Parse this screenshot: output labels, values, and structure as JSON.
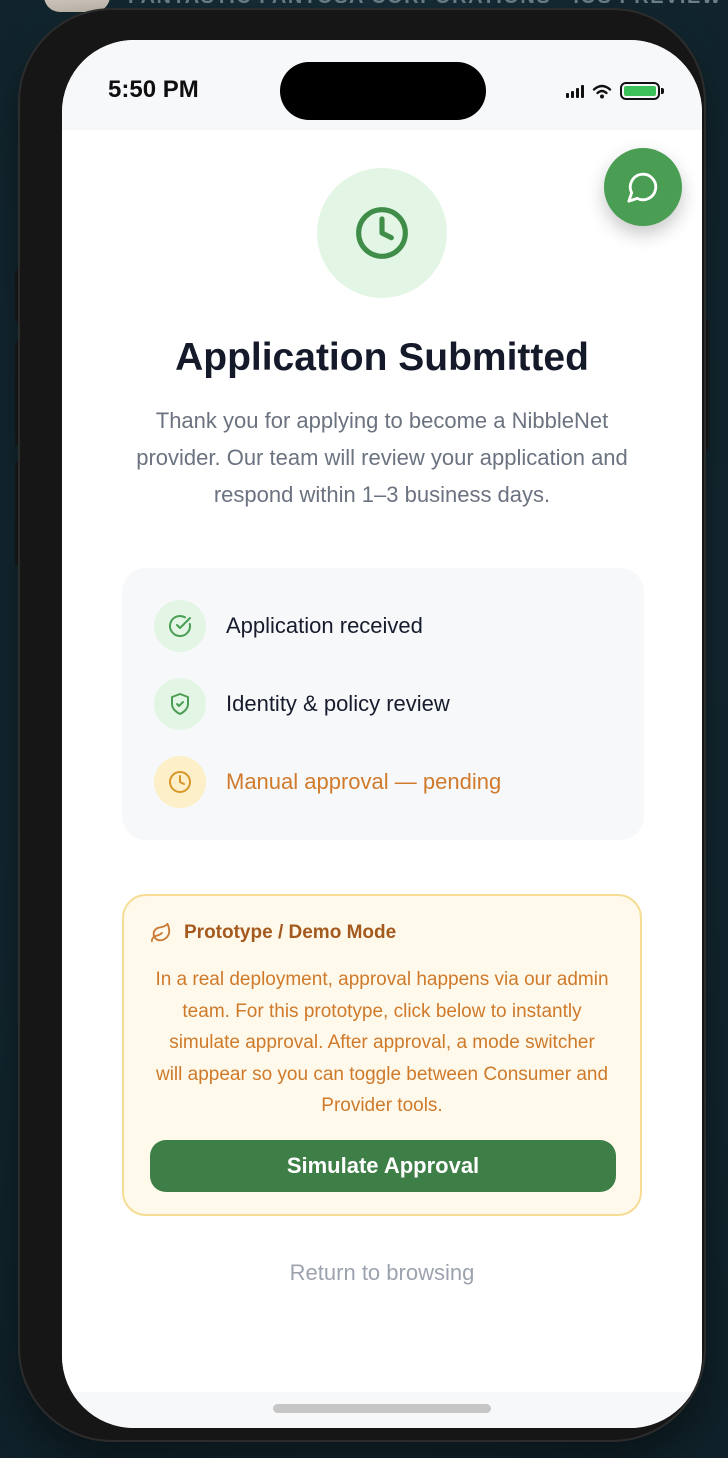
{
  "banner": {
    "text": "FANTASTIC FANTOSA CORPORATIONS · IOS PREVIEW"
  },
  "status_bar": {
    "time": "5:50 PM",
    "battery_color": "#3cc15a"
  },
  "chat_button": {
    "icon": "chat-bubble-icon",
    "color": "#4a9e53"
  },
  "hero": {
    "icon": "clock-icon",
    "title": "Application Submitted",
    "subtitle": "Thank you for applying to become a NibbleNet provider. Our team will review your application and respond within 1–3 business days."
  },
  "steps": [
    {
      "label": "Application received",
      "icon": "check-circle-icon",
      "status": "done"
    },
    {
      "label": "Identity & policy review",
      "icon": "shield-check-icon",
      "status": "done"
    },
    {
      "label": "Manual approval — pending",
      "icon": "clock-icon",
      "status": "pending"
    }
  ],
  "demo": {
    "icon": "leaf-icon",
    "title": "Prototype / Demo Mode",
    "text": "In a real deployment, approval happens via our admin team. For this prototype, click below to instantly simulate approval. After approval, a mode switcher will appear so you can toggle between Consumer and Provider tools.",
    "button_label": "Simulate Approval"
  },
  "return_link": "Return to browsing",
  "colors": {
    "primary_green": "#3e7f48",
    "success_green": "#4a9e53",
    "pending_orange": "#d07a2c",
    "demo_background": "#fef9ea"
  }
}
